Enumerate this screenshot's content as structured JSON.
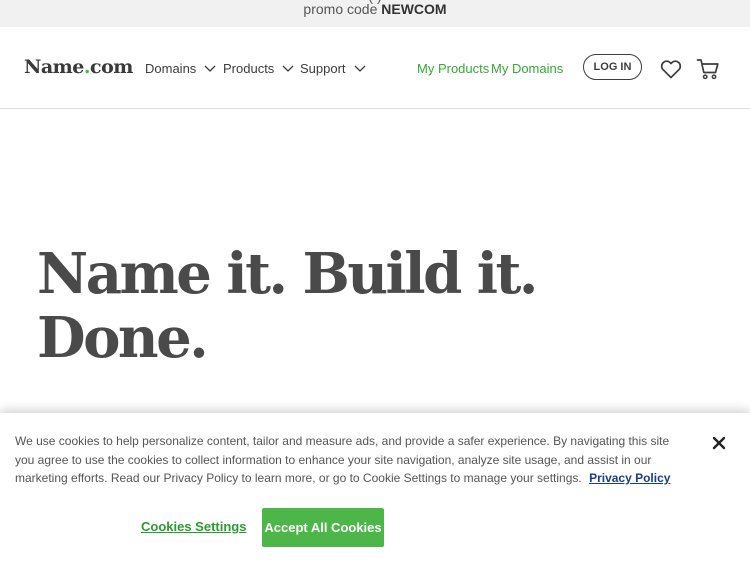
{
  "promo": {
    "top_line": "(                                                                                                                    )",
    "text": "promo code ",
    "code": "NEWCOM"
  },
  "header": {
    "logo_name": "Name",
    "logo_dot": ".",
    "logo_tld": "com",
    "nav": [
      {
        "label": "Domains"
      },
      {
        "label": "Products"
      },
      {
        "label": "Support"
      }
    ],
    "my_products": "My Products",
    "my_domains": "My Domains",
    "login": "LOG IN",
    "icons": [
      "heart-icon",
      "cart-icon",
      "chevron-down-icon"
    ]
  },
  "hero": {
    "line1": "Name it. Build it.",
    "line2": "Done."
  },
  "cookie_banner": {
    "text": "We use cookies to help personalize content, tailor and measure ads, and provide a safer experience. By navigating this site you agree to use the cookies to collect information to enhance your site navigation, analyze site usage, and assist in our marketing efforts. Read our Privacy Policy to learn more, or go to Cookie Settings to manage your settings.",
    "privacy_link": "Privacy Policy",
    "settings_button": "Cookies Settings",
    "accept_button": "Accept All Cookies",
    "close_icon": "close-icon"
  },
  "colors": {
    "accent_green": "#4cb748",
    "link_green": "#3aa63a",
    "text_dark": "#3d3d3d",
    "promo_bg": "#f1f1f1",
    "privacy_blue": "#1a3c8c"
  }
}
